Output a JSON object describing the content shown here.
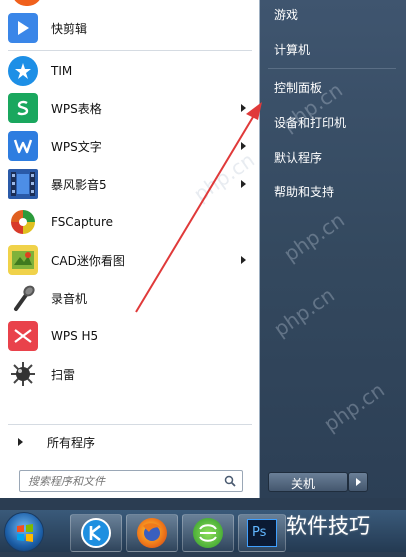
{
  "left_menu": {
    "programs": [
      {
        "label": "快剪辑",
        "icon": "kuaijianji-icon",
        "color": "#3a86e8",
        "has_submenu": false
      },
      {
        "label": "TIM",
        "icon": "tim-icon",
        "color": "#1d8fe6",
        "has_submenu": false
      },
      {
        "label": "WPS表格",
        "icon": "wps-spreadsheet-icon",
        "color": "#1aa75e",
        "has_submenu": true
      },
      {
        "label": "WPS文字",
        "icon": "wps-writer-icon",
        "color": "#2e7de0",
        "has_submenu": true
      },
      {
        "label": "暴风影音5",
        "icon": "baofeng-icon",
        "color": "#2a5aa8",
        "has_submenu": true
      },
      {
        "label": "FSCapture",
        "icon": "fscapture-icon",
        "color": "#d44a2a",
        "has_submenu": false
      },
      {
        "label": "CAD迷你看图",
        "icon": "cad-viewer-icon",
        "color": "#88b03a",
        "has_submenu": true
      },
      {
        "label": "录音机",
        "icon": "microphone-icon",
        "color": "#444444",
        "has_submenu": false
      },
      {
        "label": "WPS H5",
        "icon": "wps-h5-icon",
        "color": "#e9424b",
        "has_submenu": false
      },
      {
        "label": "扫雷",
        "icon": "minesweeper-icon",
        "color": "#555555",
        "has_submenu": false
      }
    ],
    "all_programs": "所有程序",
    "search_placeholder": "搜索程序和文件"
  },
  "right_menu": {
    "items": [
      "游戏",
      "计算机",
      "控制面板",
      "设备和打印机",
      "默认程序",
      "帮助和支持"
    ],
    "shutdown_label": "关机"
  },
  "taskbar": {
    "apps": [
      "kuaijianji-taskbar-icon",
      "firefox-icon",
      "360-browser-icon",
      "photoshop-icon"
    ],
    "photoshop_text": "Ps"
  },
  "watermark_text": "php.cn",
  "watermark_bottom": "软件技巧",
  "colors": {
    "accent_arrow": "#e03a3a",
    "right_pane": "#34495f",
    "taskbar": "#243a52"
  }
}
